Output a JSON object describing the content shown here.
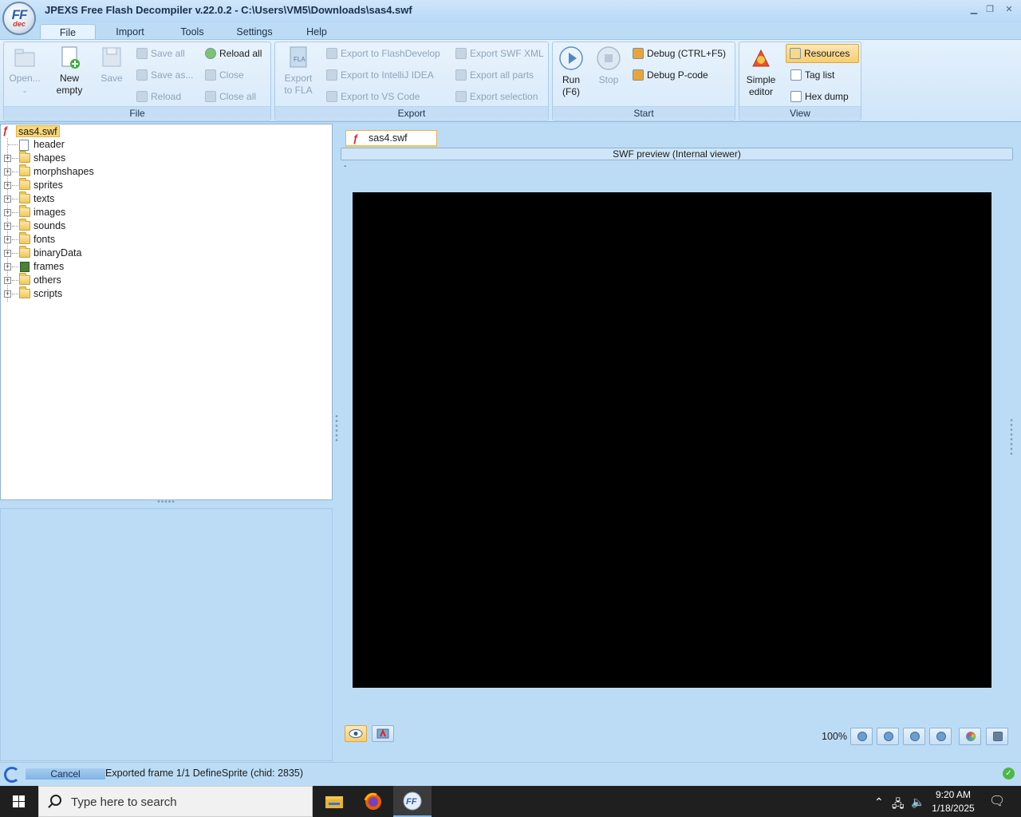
{
  "window": {
    "title": "JPEXS Free Flash Decompiler v.22.0.2 - C:\\Users\\VM5\\Downloads\\sas4.swf",
    "logo_ff": "FF",
    "logo_dec": "dec"
  },
  "ribbon_tabs": [
    "File",
    "Import",
    "Tools",
    "Settings",
    "Help"
  ],
  "ribbon": {
    "file": {
      "open": "Open...",
      "new_line1": "New",
      "new_line2": "empty",
      "save": "Save",
      "save_all": "Save all",
      "save_as": "Save as...",
      "reload": "Reload",
      "reload_all": "Reload all",
      "close": "Close",
      "close_all": "Close all",
      "label": "File"
    },
    "export": {
      "export_fla_line1": "Export",
      "export_fla_line2": "to FLA",
      "flashdevelop": "Export to FlashDevelop",
      "intellij": "Export to IntelliJ IDEA",
      "vscode": "Export to VS Code",
      "swf_xml": "Export SWF XML",
      "all_parts": "Export all parts",
      "selection": "Export selection",
      "label": "Export"
    },
    "start": {
      "run_line1": "Run",
      "run_line2": "(F6)",
      "stop": "Stop",
      "debug": "Debug (CTRL+F5)",
      "debug_pcode": "Debug P-code",
      "label": "Start"
    },
    "view": {
      "simple_line1": "Simple",
      "simple_line2": "editor",
      "resources": "Resources",
      "tag_list": "Tag list",
      "hex_dump": "Hex dump",
      "label": "View"
    }
  },
  "tree": {
    "root": "sas4.swf",
    "items": [
      "header",
      "shapes",
      "morphshapes",
      "sprites",
      "texts",
      "images",
      "sounds",
      "fonts",
      "binaryData",
      "frames",
      "others",
      "scripts"
    ]
  },
  "preview": {
    "tab_label": "sas4.swf",
    "header": "SWF preview (Internal viewer)",
    "dash": "-",
    "zoom": "100%"
  },
  "status": {
    "cancel": "Cancel",
    "message": "Exported frame 1/1 DefineSprite (chid: 2835)"
  },
  "taskbar": {
    "search_placeholder": "Type here to search",
    "time": "9:20 AM",
    "date": "1/18/2025"
  },
  "colors": {
    "accent": "#bcdcf6",
    "selection": "#f7cd70",
    "canvas": "#000000"
  }
}
